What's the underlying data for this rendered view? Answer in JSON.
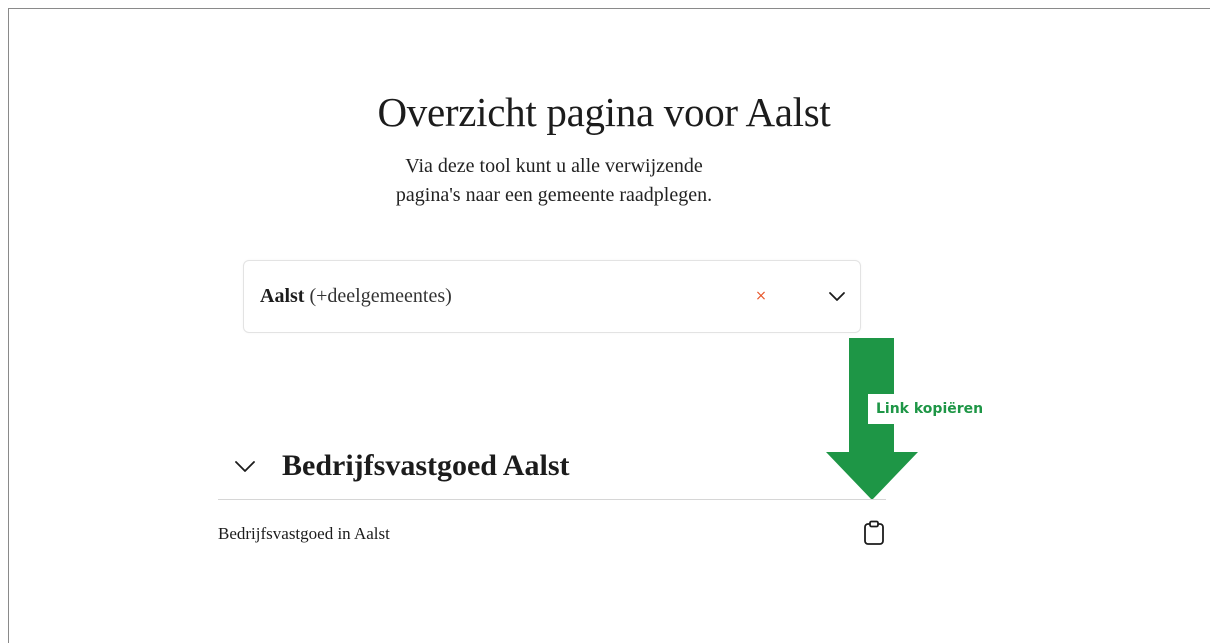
{
  "header": {
    "title": "Overzicht pagina voor Aalst",
    "subtitle_line1": "Via deze tool kunt u alle verwijzende",
    "subtitle_line2": "pagina's naar een gemeente raadplegen."
  },
  "municipality_select": {
    "value_bold": "Aalst",
    "value_suffix": "(+deelgemeentes)",
    "clear_icon": "close-icon",
    "clear_symbol": "×",
    "clear_color": "#e8582c",
    "dropdown_icon": "chevron-down-icon"
  },
  "annotation": {
    "label": "Link kopiëren",
    "arrow_color": "#1e9646",
    "label_color": "#1e9646"
  },
  "section": {
    "title": "Bedrijfsvastgoed Aalst",
    "expanded": true,
    "chevron_icon": "chevron-down-icon",
    "rows": [
      {
        "label": "Bedrijfsvastgoed in Aalst",
        "action_icon": "clipboard-icon"
      }
    ]
  }
}
